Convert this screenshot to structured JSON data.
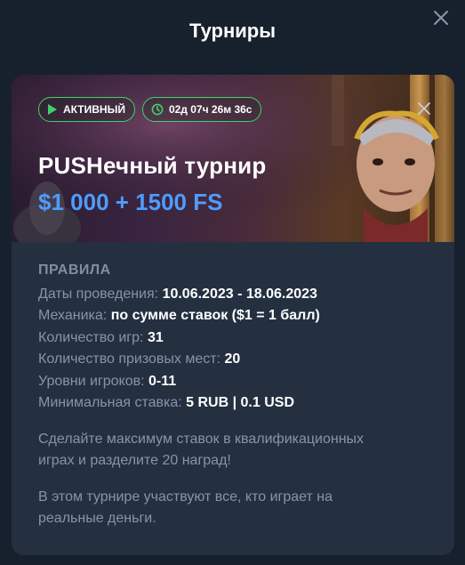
{
  "modal": {
    "title": "Турниры",
    "close_icon": "close-icon"
  },
  "banner": {
    "status_label": "АКТИВНЫЙ",
    "timer": "02д 07ч 26м 36с",
    "name": "PUSHечный турнир",
    "prize": "$1 000 + 1500 FS",
    "colors": {
      "status": "#3fd26a",
      "prize": "#4f9cff"
    }
  },
  "rules": {
    "heading": "ПРАВИЛА",
    "items": [
      {
        "label": "Даты проведения:",
        "value": "10.06.2023 - 18.06.2023"
      },
      {
        "label": "Механика:",
        "value": "по сумме ставок ($1 = 1 балл)"
      },
      {
        "label": "Количество игр:",
        "value": "31"
      },
      {
        "label": "Количество призовых мест:",
        "value": "20"
      },
      {
        "label": "Уровни игроков:",
        "value": "0-11"
      },
      {
        "label": "Минимальная ставка:",
        "value": "5 RUB | 0.1 USD"
      }
    ],
    "paragraphs": [
      "Сделайте максимум ставок в квалификационных играх и разделите 20 наград!",
      "В этом турнире участвуют все, кто играет на реальные деньги."
    ]
  }
}
